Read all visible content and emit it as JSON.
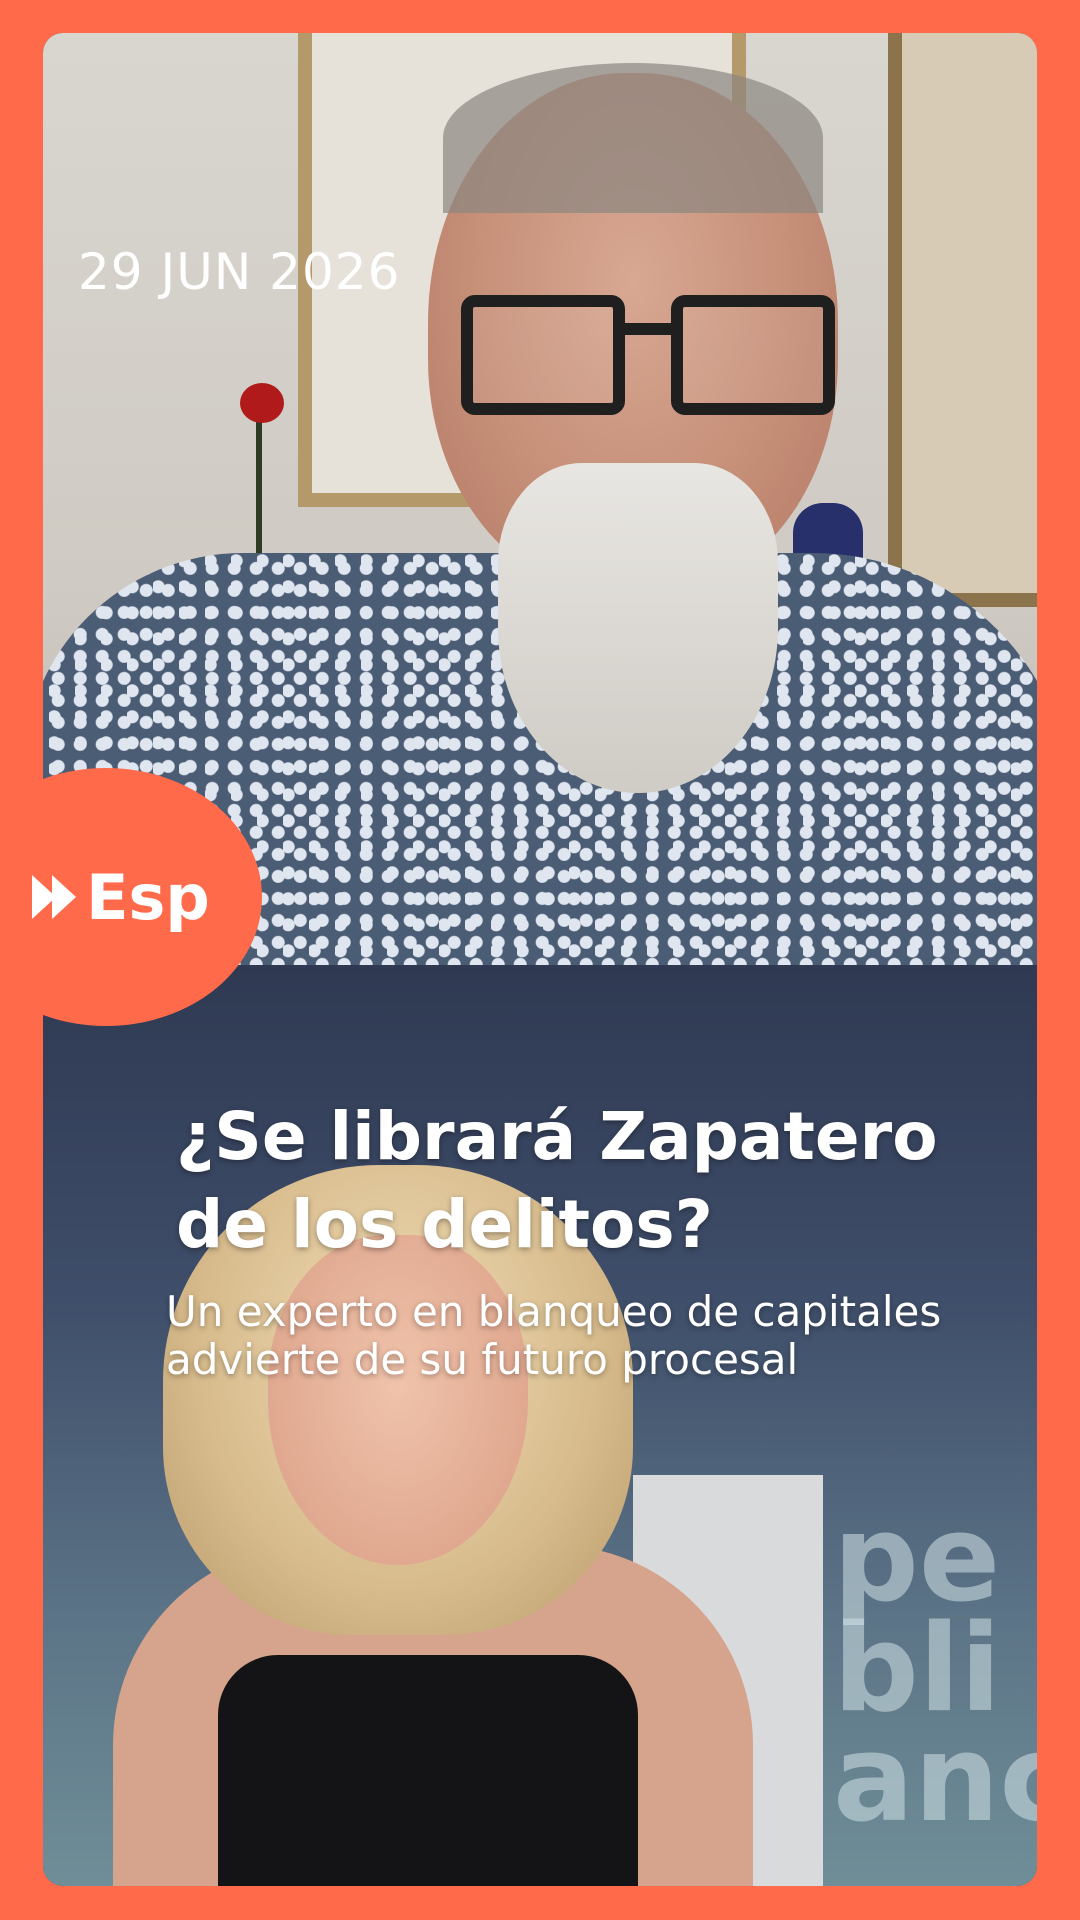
{
  "story": {
    "date": "29 JUN 2026",
    "headline_line1": "¿Se librará Zapatero",
    "headline_line2": "de los delitos?",
    "subheadline_line1": "Un experto en blanqueo de capitales",
    "subheadline_line2": "advierte de su futuro procesal"
  },
  "brand": {
    "label": "Esp",
    "icon": "fast-forward-icon",
    "accent_color": "#FF6B4A"
  },
  "background_text": {
    "line1": "pe",
    "line2": "bli",
    "line3": "anc"
  }
}
